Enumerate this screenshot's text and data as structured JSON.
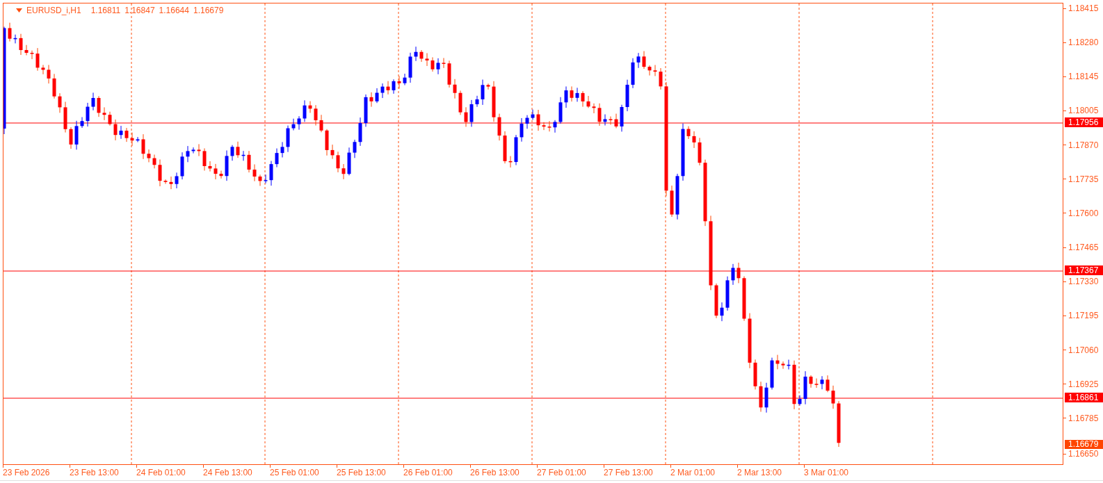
{
  "header": {
    "symbol": "EURUSD_i,H1",
    "quotes": [
      "1.16811",
      "1.16847",
      "1.16644",
      "1.16679"
    ]
  },
  "price_axis": {
    "ticks": [
      "1.18415",
      "1.18280",
      "1.18145",
      "1.18005",
      "1.17870",
      "1.17735",
      "1.17600",
      "1.17465",
      "1.17330",
      "1.17195",
      "1.17060",
      "1.16925",
      "1.16785",
      "1.16650"
    ],
    "price_lines": [
      {
        "label": "1.17956"
      },
      {
        "label": "1.17367"
      },
      {
        "label": "1.16861"
      }
    ],
    "current_price": "1.16679"
  },
  "time_axis": {
    "ticks": [
      "23 Feb 2026",
      "23 Feb 13:00",
      "24 Feb 01:00",
      "24 Feb 13:00",
      "25 Feb 01:00",
      "25 Feb 13:00",
      "26 Feb 01:00",
      "26 Feb 13:00",
      "27 Feb 01:00",
      "27 Feb 13:00",
      "2 Mar 01:00",
      "2 Mar 13:00",
      "3 Mar 01:00"
    ]
  }
}
